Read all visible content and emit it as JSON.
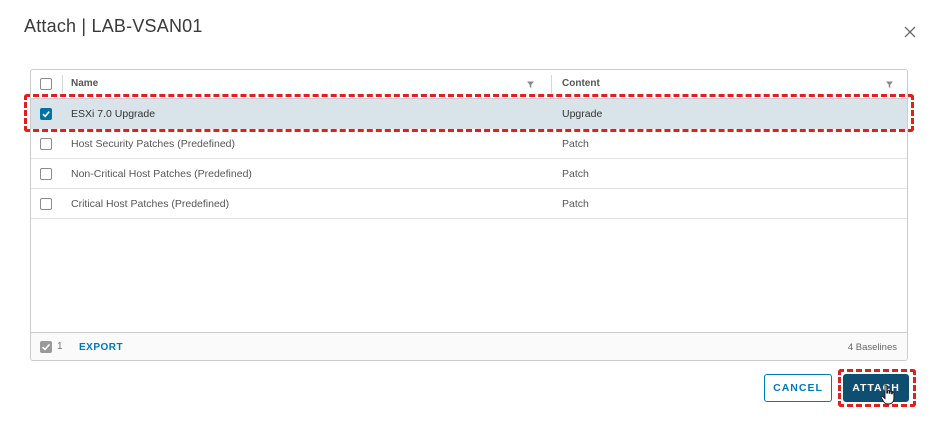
{
  "dialog": {
    "title": "Attach | LAB-VSAN01",
    "close_icon": "close-icon"
  },
  "grid": {
    "columns": [
      {
        "label": "Name",
        "filter_icon": "filter-icon"
      },
      {
        "label": "Content",
        "filter_icon": "filter-icon"
      }
    ],
    "rows": [
      {
        "name": "ESXi 7.0 Upgrade",
        "content": "Upgrade",
        "checked": true
      },
      {
        "name": "Host Security Patches (Predefined)",
        "content": "Patch",
        "checked": false
      },
      {
        "name": "Non-Critical Host Patches (Predefined)",
        "content": "Patch",
        "checked": false
      },
      {
        "name": "Critical Host Patches (Predefined)",
        "content": "Patch",
        "checked": false
      }
    ],
    "footer": {
      "selected_count": "1",
      "export_label": "EXPORT",
      "total_label": "4 Baselines"
    }
  },
  "buttons": {
    "cancel_label": "CANCEL",
    "attach_label": "ATTACH"
  },
  "colors": {
    "accent": "#0079b8",
    "primary_button": "#0e4f71",
    "selected_row": "#d9e4ea",
    "highlight_annotation": "#e41d1d"
  }
}
